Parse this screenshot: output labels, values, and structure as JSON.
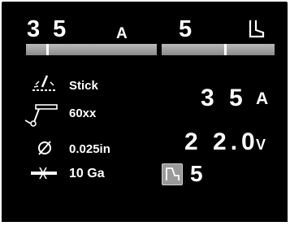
{
  "header": {
    "left_value": "3 5",
    "left_unit": "A",
    "left_bar_level_percent": 16,
    "right_value": "5",
    "right_icon": "boot-icon",
    "right_bar_level_percent": 56
  },
  "settings": [
    {
      "icon": "process-spark-icon",
      "label": "Stick"
    },
    {
      "icon": "electrode-holder-icon",
      "label": "60xx"
    },
    {
      "icon": "diameter-icon",
      "label": "0.025in"
    },
    {
      "icon": "material-thickness-icon",
      "label": "10 Ga"
    }
  ],
  "readout": {
    "current_value": "3 5",
    "current_unit": "A",
    "voltage_value": "2 2.0",
    "voltage_unit": "V",
    "arc_control_icon": "arc-control-icon",
    "arc_control_value": "5"
  },
  "colors": {
    "background": "#000000",
    "text": "#ffffff",
    "bar": "#a3a3a3",
    "icon_box": "#9a9a9a"
  }
}
